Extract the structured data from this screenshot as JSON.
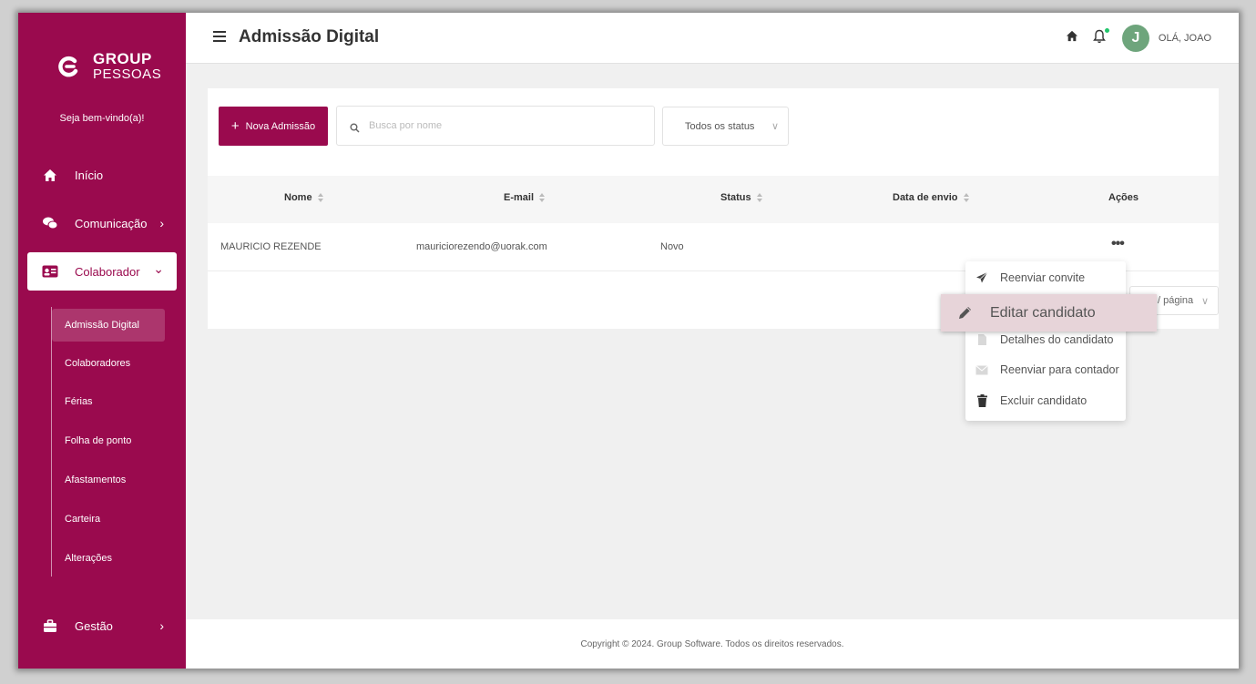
{
  "brand": {
    "line1": "GROUP",
    "line2": "PESSOAS"
  },
  "colors": {
    "primary": "#9a0a4e",
    "avatar": "#6ea57c",
    "notification_dot": "#21c56b",
    "highlight": "#e7d4d9"
  },
  "sidebar": {
    "welcome": "Seja bem-vindo(a)!",
    "items": [
      {
        "label": "Início",
        "icon": "home-icon"
      },
      {
        "label": "Comunicação",
        "icon": "chat-icon",
        "chevron": "›"
      },
      {
        "label": "Colaborador",
        "icon": "id-card-icon",
        "chevron": "⌄",
        "active": true
      }
    ],
    "submenu": [
      {
        "label": "Admissão Digital",
        "active": true
      },
      {
        "label": "Colaboradores"
      },
      {
        "label": "Férias"
      },
      {
        "label": "Folha de ponto"
      },
      {
        "label": "Afastamentos"
      },
      {
        "label": "Carteira"
      },
      {
        "label": "Alterações"
      }
    ],
    "bottom_item": {
      "label": "Gestão",
      "icon": "briefcase-icon",
      "chevron": "›"
    }
  },
  "header": {
    "title": "Admissão Digital",
    "greeting": "OLÁ, JOAO",
    "avatar_initial": "J"
  },
  "toolbar": {
    "new_button": "Nova Admissão",
    "search_placeholder": "Busca por nome",
    "status_select": "Todos os status"
  },
  "table": {
    "columns": [
      "Nome",
      "E-mail",
      "Status",
      "Data de envio",
      "Ações"
    ],
    "rows": [
      {
        "nome": "MAURICIO REZENDE",
        "email": "mauriciorezendo@uorak.com",
        "status": "Novo",
        "data_envio": "",
        "acoes": "•••"
      }
    ]
  },
  "pagination": {
    "per_page_label": "/ página",
    "chevron": "∨"
  },
  "actions_menu": {
    "items": [
      {
        "label": "Reenviar convite",
        "icon": "send-icon"
      },
      {
        "label": "Editar candidato",
        "icon": "pencil-icon",
        "highlighted": true
      },
      {
        "label": "Detalhes do candidato",
        "icon": "document-icon"
      },
      {
        "label": "Reenviar para contador",
        "icon": "envelope-icon"
      },
      {
        "label": "Excluir candidato",
        "icon": "trash-icon"
      }
    ]
  },
  "footer": {
    "copyright": "Copyright © 2024. Group Software. Todos os direitos reservados."
  }
}
